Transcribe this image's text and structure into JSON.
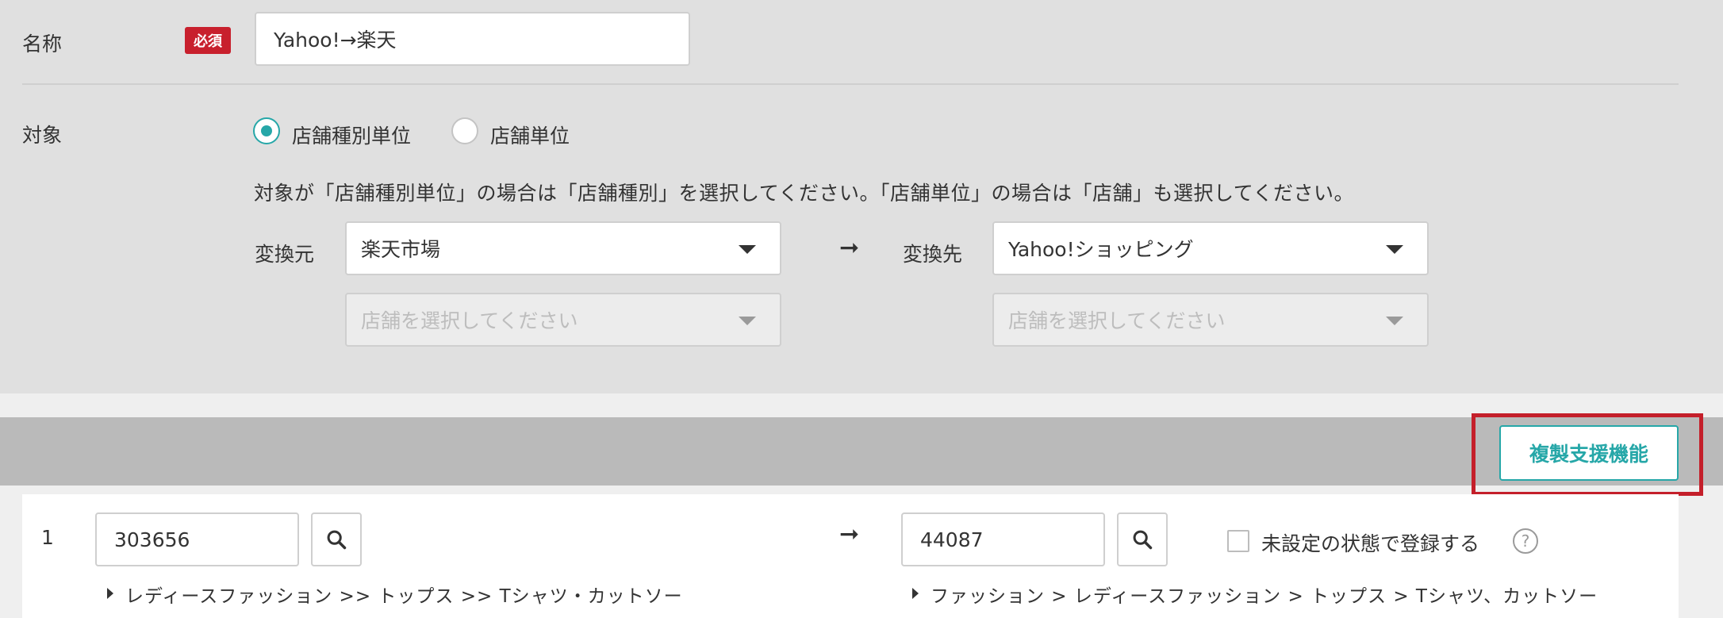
{
  "form": {
    "name_label": "名称",
    "required_badge": "必須",
    "name_value": "Yahoo!→楽天",
    "target_label": "対象",
    "radio_options": [
      {
        "label": "店舗種別単位",
        "checked": true
      },
      {
        "label": "店舗単位",
        "checked": false
      }
    ],
    "note": "対象が「店舗種別単位」の場合は「店舗種別」を選択してください。「店舗単位」の場合は「店舗」も選択してください。",
    "source_label": "変換元",
    "source_value": "楽天市場",
    "dest_label": "変換先",
    "dest_value": "Yahoo!ショッピング",
    "store_placeholder": "店舗を選択してください",
    "arrow": "➞"
  },
  "toolbar": {
    "copy_support_label": "複製支援機能"
  },
  "mapping_rows": [
    {
      "index": "1",
      "source_code": "303656",
      "source_path": "レディースファッション >> トップス >> Tシャツ・カットソー",
      "dest_code": "44087",
      "dest_path": "ファッション > レディースファッション > トップス > Tシャツ、カットソー",
      "unset_label": "未設定の状態で登録する",
      "help_glyph": "?"
    }
  ],
  "colors": {
    "accent": "#26a7a8",
    "required": "#c8202d",
    "highlight": "#c41f2a"
  },
  "icons": [
    "search-icon",
    "help-icon",
    "caret-down-icon",
    "arrow-right-icon",
    "expand-triangle-icon"
  ]
}
